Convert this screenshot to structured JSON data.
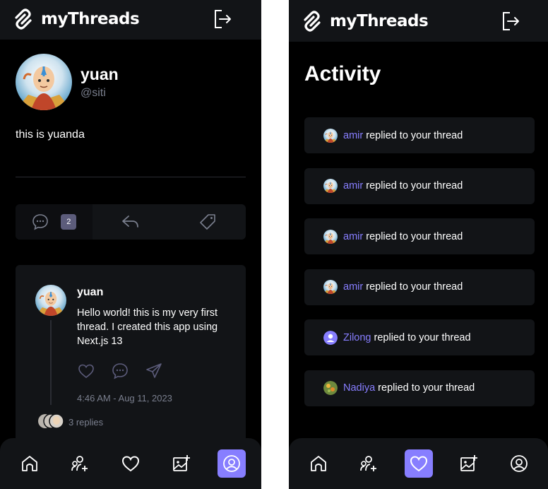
{
  "app": {
    "name": "myThreads"
  },
  "profile": {
    "name": "yuan",
    "handle": "@siti",
    "bio": "this is yuanda",
    "threads_count": "2"
  },
  "thread": {
    "author": "yuan",
    "text": "Hello world! this is my very first thread. I created this app using Next.js 13",
    "date": "4:46 AM - Aug 11, 2023",
    "replies": "3 replies"
  },
  "activity": {
    "title": "Activity",
    "action_text": "replied to your thread",
    "items": [
      {
        "name": "amir",
        "avatar": "avatar-airbender"
      },
      {
        "name": "amir",
        "avatar": "avatar-airbender"
      },
      {
        "name": "amir",
        "avatar": "avatar-airbender"
      },
      {
        "name": "amir",
        "avatar": "avatar-airbender"
      },
      {
        "name": "Zilong",
        "avatar": "avatar-default"
      },
      {
        "name": "Nadiya",
        "avatar": "avatar-flowers"
      }
    ]
  },
  "colors": {
    "accent": "#877eff",
    "card": "#121417",
    "muted": "#7a7f8e"
  }
}
